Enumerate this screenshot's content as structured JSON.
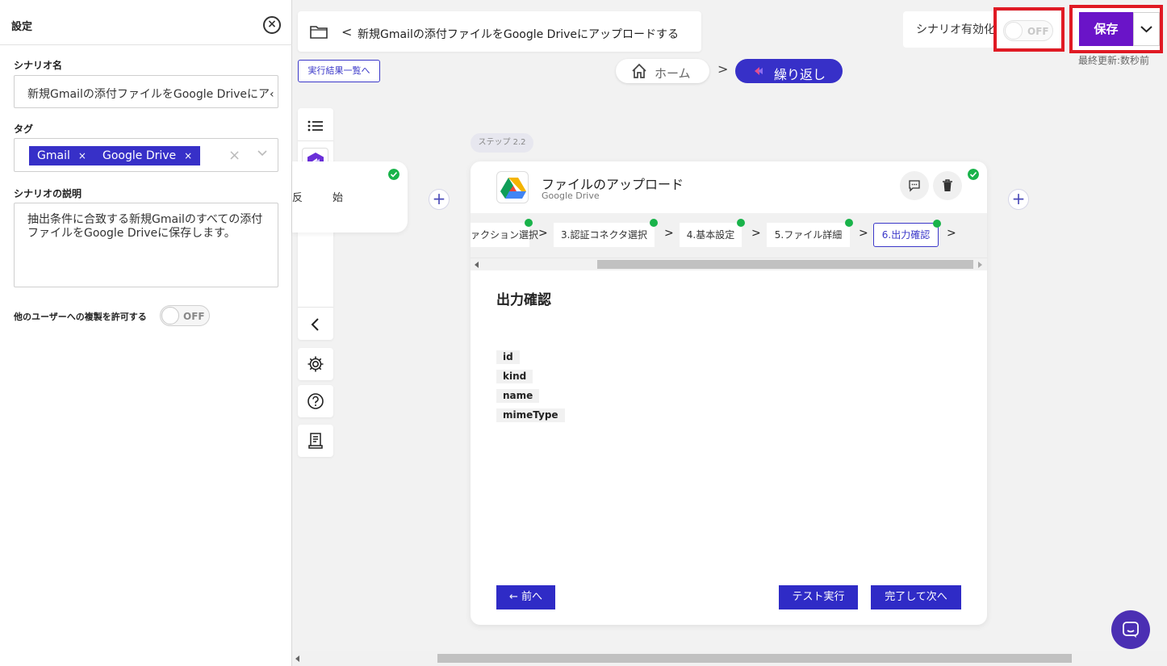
{
  "settings": {
    "title": "設定",
    "name_label": "シナリオ名",
    "name_value": "新規Gmailの添付ファイルをGoogle Driveにア‹",
    "tag_label": "タグ",
    "tags": [
      "Gmail",
      "Google Drive"
    ],
    "tag_remove": "×",
    "tags_clear": "×",
    "desc_label": "シナリオの説明",
    "desc_value": "抽出条件に合致する新規Gmailのすべての添付ファイルをGoogle Driveに保存します。",
    "copy_label": "他のユーザーへの複製を許可する",
    "copy_toggle": "OFF"
  },
  "header": {
    "scenario_title": "新規Gmailの添付ファイルをGoogle Driveにアップロードする",
    "back": "<",
    "results_button": "実行結果一覧へ",
    "enable_label": "シナリオ有効化",
    "enable_toggle": "OFF",
    "save_button": "保存",
    "last_updated": "最終更新:数秒前"
  },
  "breadcrumb": {
    "home": "ホーム",
    "separator": ">",
    "current": "繰り返し"
  },
  "canvas": {
    "start_node_left": "反",
    "start_node_right": "始",
    "step_badge": "ステップ  2.2",
    "add": "+"
  },
  "card": {
    "title": "ファイルのアップロード",
    "subtitle": "Google Drive",
    "steps": [
      "ァクション選択",
      "3.認証コネクタ選択",
      "4.基本設定",
      "5.ファイル詳細",
      "6.出力確認"
    ],
    "arrow": ">",
    "section_title": "出力確認",
    "fields": [
      "id",
      "kind",
      "name",
      "mimeType"
    ],
    "prev_button": "← 前へ",
    "test_button": "テスト実行",
    "next_button": "完了して次へ"
  },
  "colors": {
    "accent": "#3730c8",
    "save": "#6a14c8",
    "success": "#19b34a",
    "highlight": "#e01a24"
  }
}
